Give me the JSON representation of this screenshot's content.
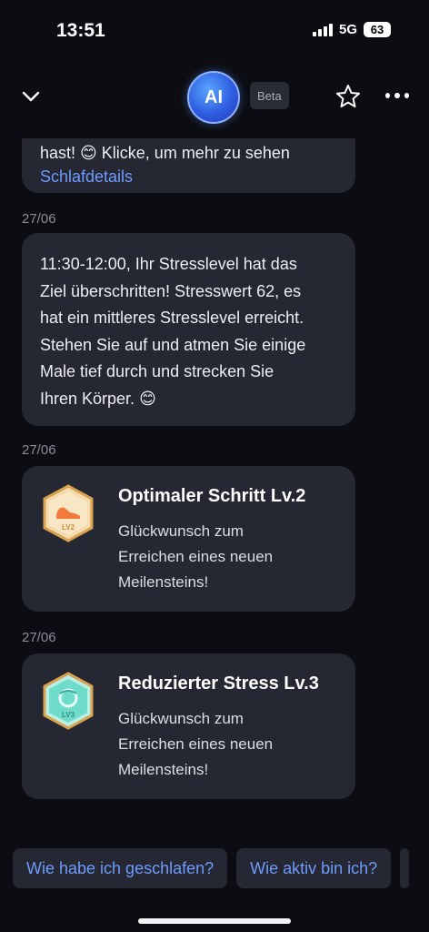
{
  "status": {
    "time": "13:51",
    "network": "5G",
    "battery": "63"
  },
  "header": {
    "logo_text": "AI",
    "beta_label": "Beta",
    "collapse_icon": "chevron-down-icon",
    "favorite_icon": "star-icon",
    "more_icon": "more-dots-icon"
  },
  "messages": [
    {
      "partial_text": "hast! 😊 Klicke, um mehr zu sehen",
      "link": "Schlafdetails"
    },
    {
      "date": "27/06",
      "lines": [
        "11:30-12:00, Ihr Stresslevel hat das",
        "Ziel überschritten! Stresswert 62, es",
        "hat ein mittleres Stresslevel erreicht.",
        "Stehen Sie auf und atmen Sie einige",
        "Male tief durch und strecken Sie",
        "Ihren Körper. 😊"
      ]
    },
    {
      "date": "27/06",
      "title": "Optimaler Schritt Lv.2",
      "desc_lines": [
        "Glückwunsch zum",
        "Erreichen eines neuen",
        "Meilensteins!"
      ],
      "badge_label": "LV2",
      "badge_icon": "shoe-badge-icon"
    },
    {
      "date": "27/06",
      "title": "Reduzierter Stress Lv.3",
      "desc_lines": [
        "Glückwunsch zum",
        "Erreichen eines neuen",
        "Meilensteins!"
      ],
      "badge_label": "LV3",
      "badge_icon": "stress-badge-icon"
    }
  ],
  "suggestions": [
    "Wie habe ich geschlafen?",
    "Wie aktiv bin ich?"
  ],
  "colors": {
    "background": "#0c0d12",
    "bubble": "#252733",
    "link": "#6e9bff",
    "badge_gold": "#e8b25c",
    "badge_teal": "#5fd6c8"
  }
}
